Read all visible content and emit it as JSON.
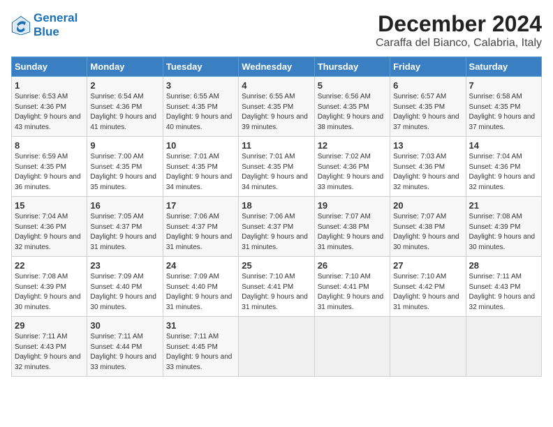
{
  "logo": {
    "line1": "General",
    "line2": "Blue"
  },
  "title": "December 2024",
  "subtitle": "Caraffa del Bianco, Calabria, Italy",
  "headers": [
    "Sunday",
    "Monday",
    "Tuesday",
    "Wednesday",
    "Thursday",
    "Friday",
    "Saturday"
  ],
  "weeks": [
    [
      {
        "day": "1",
        "sunrise": "6:53 AM",
        "sunset": "4:36 PM",
        "daylight": "9 hours and 43 minutes."
      },
      {
        "day": "2",
        "sunrise": "6:54 AM",
        "sunset": "4:36 PM",
        "daylight": "9 hours and 41 minutes."
      },
      {
        "day": "3",
        "sunrise": "6:55 AM",
        "sunset": "4:35 PM",
        "daylight": "9 hours and 40 minutes."
      },
      {
        "day": "4",
        "sunrise": "6:55 AM",
        "sunset": "4:35 PM",
        "daylight": "9 hours and 39 minutes."
      },
      {
        "day": "5",
        "sunrise": "6:56 AM",
        "sunset": "4:35 PM",
        "daylight": "9 hours and 38 minutes."
      },
      {
        "day": "6",
        "sunrise": "6:57 AM",
        "sunset": "4:35 PM",
        "daylight": "9 hours and 37 minutes."
      },
      {
        "day": "7",
        "sunrise": "6:58 AM",
        "sunset": "4:35 PM",
        "daylight": "9 hours and 37 minutes."
      }
    ],
    [
      {
        "day": "8",
        "sunrise": "6:59 AM",
        "sunset": "4:35 PM",
        "daylight": "9 hours and 36 minutes."
      },
      {
        "day": "9",
        "sunrise": "7:00 AM",
        "sunset": "4:35 PM",
        "daylight": "9 hours and 35 minutes."
      },
      {
        "day": "10",
        "sunrise": "7:01 AM",
        "sunset": "4:35 PM",
        "daylight": "9 hours and 34 minutes."
      },
      {
        "day": "11",
        "sunrise": "7:01 AM",
        "sunset": "4:35 PM",
        "daylight": "9 hours and 34 minutes."
      },
      {
        "day": "12",
        "sunrise": "7:02 AM",
        "sunset": "4:36 PM",
        "daylight": "9 hours and 33 minutes."
      },
      {
        "day": "13",
        "sunrise": "7:03 AM",
        "sunset": "4:36 PM",
        "daylight": "9 hours and 32 minutes."
      },
      {
        "day": "14",
        "sunrise": "7:04 AM",
        "sunset": "4:36 PM",
        "daylight": "9 hours and 32 minutes."
      }
    ],
    [
      {
        "day": "15",
        "sunrise": "7:04 AM",
        "sunset": "4:36 PM",
        "daylight": "9 hours and 32 minutes."
      },
      {
        "day": "16",
        "sunrise": "7:05 AM",
        "sunset": "4:37 PM",
        "daylight": "9 hours and 31 minutes."
      },
      {
        "day": "17",
        "sunrise": "7:06 AM",
        "sunset": "4:37 PM",
        "daylight": "9 hours and 31 minutes."
      },
      {
        "day": "18",
        "sunrise": "7:06 AM",
        "sunset": "4:37 PM",
        "daylight": "9 hours and 31 minutes."
      },
      {
        "day": "19",
        "sunrise": "7:07 AM",
        "sunset": "4:38 PM",
        "daylight": "9 hours and 31 minutes."
      },
      {
        "day": "20",
        "sunrise": "7:07 AM",
        "sunset": "4:38 PM",
        "daylight": "9 hours and 30 minutes."
      },
      {
        "day": "21",
        "sunrise": "7:08 AM",
        "sunset": "4:39 PM",
        "daylight": "9 hours and 30 minutes."
      }
    ],
    [
      {
        "day": "22",
        "sunrise": "7:08 AM",
        "sunset": "4:39 PM",
        "daylight": "9 hours and 30 minutes."
      },
      {
        "day": "23",
        "sunrise": "7:09 AM",
        "sunset": "4:40 PM",
        "daylight": "9 hours and 30 minutes."
      },
      {
        "day": "24",
        "sunrise": "7:09 AM",
        "sunset": "4:40 PM",
        "daylight": "9 hours and 31 minutes."
      },
      {
        "day": "25",
        "sunrise": "7:10 AM",
        "sunset": "4:41 PM",
        "daylight": "9 hours and 31 minutes."
      },
      {
        "day": "26",
        "sunrise": "7:10 AM",
        "sunset": "4:41 PM",
        "daylight": "9 hours and 31 minutes."
      },
      {
        "day": "27",
        "sunrise": "7:10 AM",
        "sunset": "4:42 PM",
        "daylight": "9 hours and 31 minutes."
      },
      {
        "day": "28",
        "sunrise": "7:11 AM",
        "sunset": "4:43 PM",
        "daylight": "9 hours and 32 minutes."
      }
    ],
    [
      {
        "day": "29",
        "sunrise": "7:11 AM",
        "sunset": "4:43 PM",
        "daylight": "9 hours and 32 minutes."
      },
      {
        "day": "30",
        "sunrise": "7:11 AM",
        "sunset": "4:44 PM",
        "daylight": "9 hours and 33 minutes."
      },
      {
        "day": "31",
        "sunrise": "7:11 AM",
        "sunset": "4:45 PM",
        "daylight": "9 hours and 33 minutes."
      },
      null,
      null,
      null,
      null
    ]
  ]
}
